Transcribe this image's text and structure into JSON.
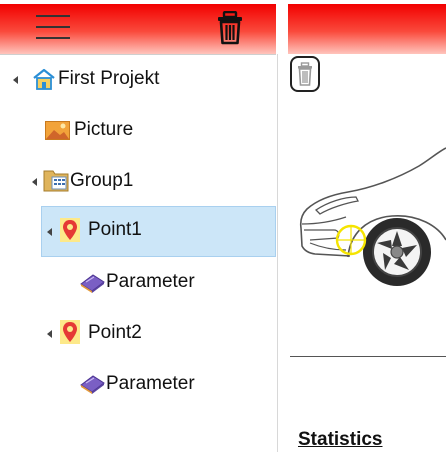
{
  "tree": {
    "root": {
      "label": "First Projekt",
      "icon": "home-folder-icon"
    },
    "picture": {
      "label": "Picture",
      "icon": "image-icon"
    },
    "group1": {
      "label": "Group1",
      "icon": "folder-grid-icon"
    },
    "point1": {
      "label": "Point1",
      "icon": "map-pin-icon",
      "selected": true
    },
    "point1_param": {
      "label": "Parameter",
      "icon": "parameter-book-icon"
    },
    "point2": {
      "label": "Point2",
      "icon": "map-pin-icon"
    },
    "point2_param": {
      "label": "Parameter",
      "icon": "parameter-book-icon"
    }
  },
  "toolbar": {
    "menu_icon": "hamburger-icon",
    "delete_icon": "trash-icon"
  },
  "right_panel": {
    "delete_icon": "trash-icon",
    "image": "car-front-wheel-illustration",
    "statistics_heading": "Statistics"
  },
  "colors": {
    "header_red": "#f20000",
    "selection_blue": "#cce6f8",
    "marker_yellow": "#f5e400",
    "pin_red": "#e53935"
  }
}
